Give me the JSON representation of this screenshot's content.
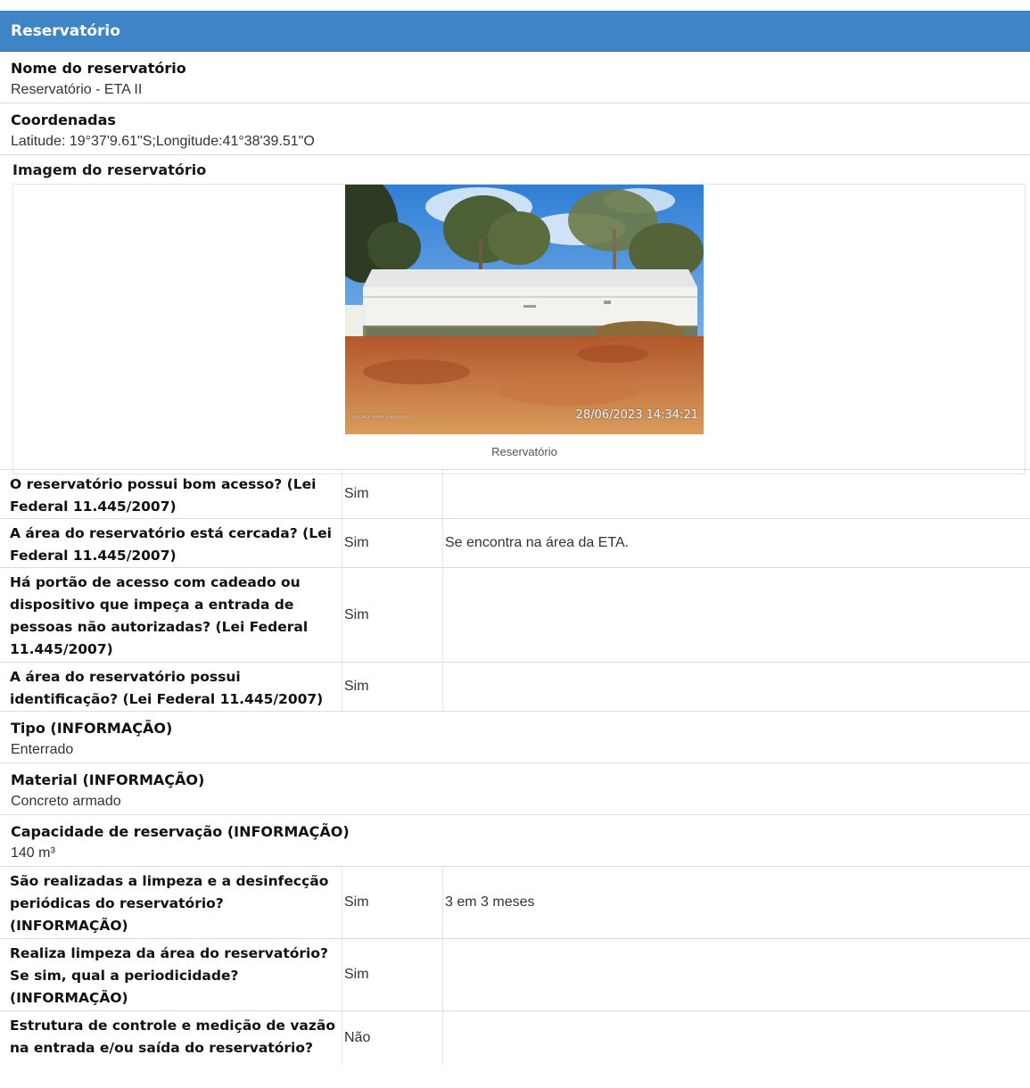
{
  "header": {
    "title": "Reservatório"
  },
  "fields": {
    "nome": {
      "label": "Nome do reservatório",
      "value": "Reservatório - ETA II"
    },
    "coordenadas": {
      "label": "Coordenadas",
      "value": "Latitude: 19°37'9.61\"S;Longitude:41°38'39.51\"O"
    },
    "imagem": {
      "label": "Imagem do reservatório",
      "caption": "Reservatório",
      "timestamp": "28/06/2023 14:34:21"
    },
    "tipo": {
      "label": "Tipo (INFORMAÇÃO)",
      "value": "Enterrado"
    },
    "material": {
      "label": "Material (INFORMAÇÃO)",
      "value": "Concreto armado"
    },
    "capacidade": {
      "label": "Capacidade de reservação (INFORMAÇÃO)",
      "value": "140 m³"
    }
  },
  "questions": [
    {
      "question": "O reservatório possui bom acesso? (Lei Federal 11.445/2007)",
      "answer": "Sim",
      "note": ""
    },
    {
      "question": "A área do reservatório está cercada? (Lei Federal 11.445/2007)",
      "answer": "Sim",
      "note": "Se encontra na área da ETA."
    },
    {
      "question": "Há portão de acesso com cadeado ou dispositivo que impeça a entrada de pessoas não autorizadas? (Lei Federal 11.445/2007)",
      "answer": "Sim",
      "note": ""
    },
    {
      "question": "A área do reservatório possui identificação? (Lei Federal 11.445/2007)",
      "answer": "Sim",
      "note": ""
    },
    {
      "question": "São realizadas a limpeza e a desinfecção periódicas do reservatório? (INFORMAÇÃO)",
      "answer": "Sim",
      "note": "3 em 3 meses"
    },
    {
      "question": "Realiza limpeza da área do reservatório? Se sim, qual a periodicidade? (INFORMAÇÃO)",
      "answer": "Sim",
      "note": ""
    },
    {
      "question": "Estrutura de controle e medição de vazão na entrada e/ou saída do reservatório?",
      "answer": "Não",
      "note": ""
    }
  ]
}
